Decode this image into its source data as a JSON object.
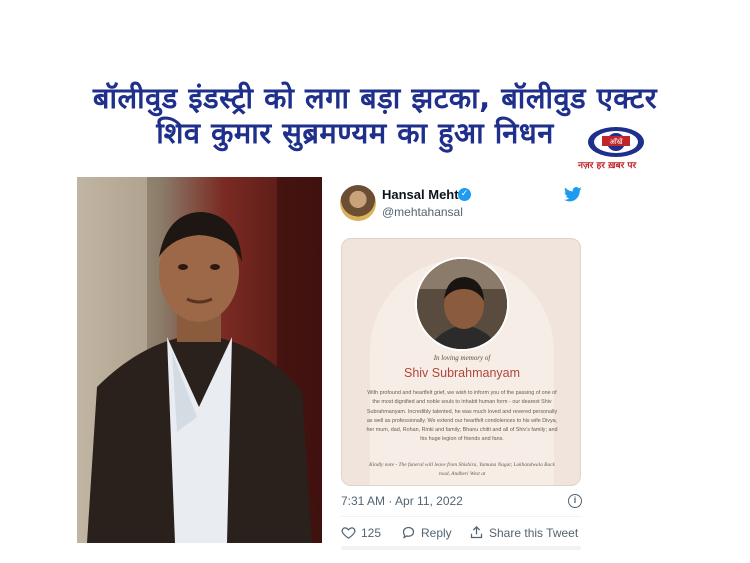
{
  "headline": {
    "line1": "बॉलीवुड इंडस्ट्री को लगा बड़ा झटका, बॉलीवुड एक्टर",
    "line2": "शिव कुमार सुब्रमण्यम का हुआ निधन"
  },
  "logo": {
    "wordmark": "आँखें",
    "tagline": "नज़र हर ख़बर पर"
  },
  "tweet": {
    "author_name": "Hansal Mehta",
    "author_handle": "@mehtahansal",
    "card": {
      "in_loving_memory": "In loving memory of",
      "name": "Shiv Subrahmanyam",
      "body": "With profound and heartfelt grief, we wish to inform you of the passing of one of the most dignified and noble souls to inhabit human form - our dearest Shiv Subrahmanyam. Incredibly talented, he was much loved and revered personally as well as professionally. We extend our heartfelt condolences to his wife Divya, her mum, dad, Rohan, Rinki and family; Bhanu chitti and all of Shiv's family; and his huge legion of friends and fans.",
      "note": "Kindly note - The funeral will leave from Shishira, Yamuna Nagar, Lokhandwala Back road, Andheri West at"
    },
    "timestamp": "7:31 AM · Apr 11, 2022",
    "likes": "125",
    "reply_label": "Reply",
    "share_label": "Share this Tweet"
  },
  "colors": {
    "headline": "#1f2f8c",
    "twitter_blue": "#1d9bf0",
    "card_name": "#b0463c",
    "logo_red": "#c0272d"
  },
  "icons": [
    "verified-icon",
    "twitter-bird-icon",
    "info-icon",
    "heart-icon",
    "reply-icon",
    "share-icon"
  ]
}
